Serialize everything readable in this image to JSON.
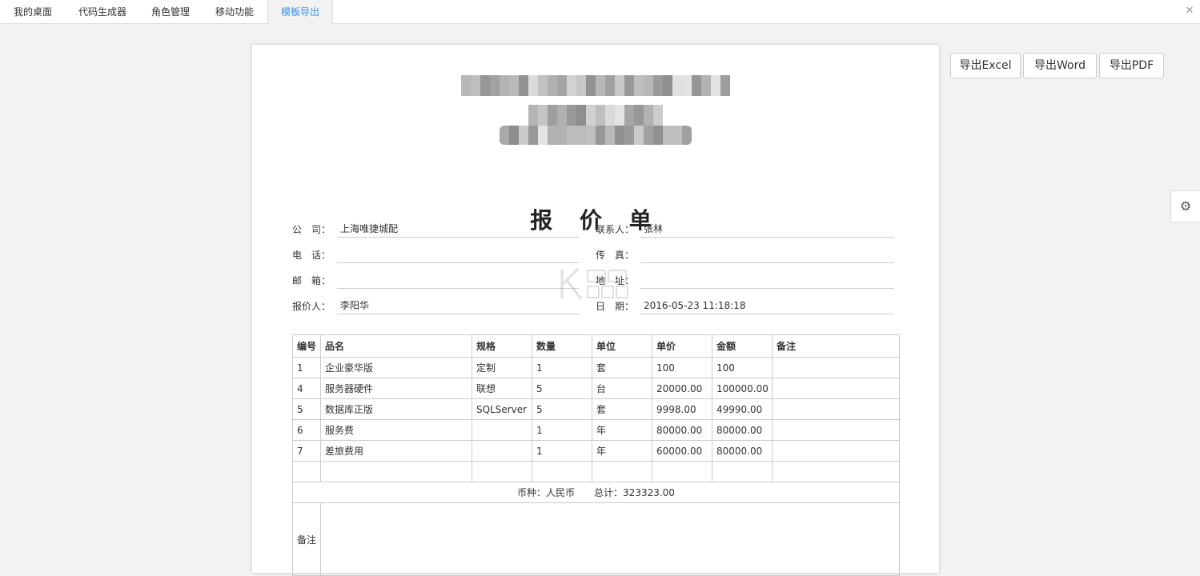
{
  "tabs": [
    {
      "label": "我的桌面"
    },
    {
      "label": "代码生成器"
    },
    {
      "label": "角色管理"
    },
    {
      "label": "移动功能"
    },
    {
      "label": "模板导出"
    }
  ],
  "active_tab": 4,
  "toolbar": {
    "export_excel": "导出Excel",
    "export_word": "导出Word",
    "export_pdf": "导出PDF"
  },
  "icons": {
    "close_all": "close-icon",
    "settings": "gear-icon"
  },
  "document": {
    "title": "报 价 单",
    "fields": {
      "company_label": "公　司：",
      "company_value": "上海唯捷城配",
      "contact_label": "联系人：",
      "contact_value": "张林",
      "phone_label": "电　话：",
      "phone_value": "",
      "fax_label": "传　真：",
      "fax_value": "",
      "email_label": "邮　箱：",
      "email_value": "",
      "address_label": "地　址：",
      "address_value": "",
      "quoter_label": "报价人：",
      "quoter_value": "李阳华",
      "date_label": "日　期：",
      "date_value": "2016-05-23 11:18:18"
    },
    "table": {
      "headers": [
        "编号",
        "品名",
        "规格",
        "数量",
        "单位",
        "单价",
        "金额",
        "备注"
      ],
      "rows": [
        [
          "1",
          "企业豪华版",
          "定制",
          "1",
          "套",
          "100",
          "100",
          ""
        ],
        [
          "4",
          "服务器硬件",
          "联想",
          "5",
          "台",
          "20000.00",
          "100000.00",
          ""
        ],
        [
          "5",
          "数据库正版",
          "SQLServer",
          "5",
          "套",
          "9998.00",
          "49990.00",
          ""
        ],
        [
          "6",
          "服务费",
          "",
          "1",
          "年",
          "80000.00",
          "80000.00",
          ""
        ],
        [
          "7",
          "差旅费用",
          "",
          "1",
          "年",
          "60000.00",
          "80000.00",
          ""
        ],
        [
          "",
          "",
          "",
          "",
          "",
          "",
          "",
          ""
        ]
      ],
      "total_text": "币种：人民币　　总计：323323.00",
      "remark_label": "备注",
      "remark_value": ""
    }
  },
  "colors": {
    "accent": "#3a8ee6",
    "border": "#cccccc",
    "background": "#f2f2f2"
  }
}
